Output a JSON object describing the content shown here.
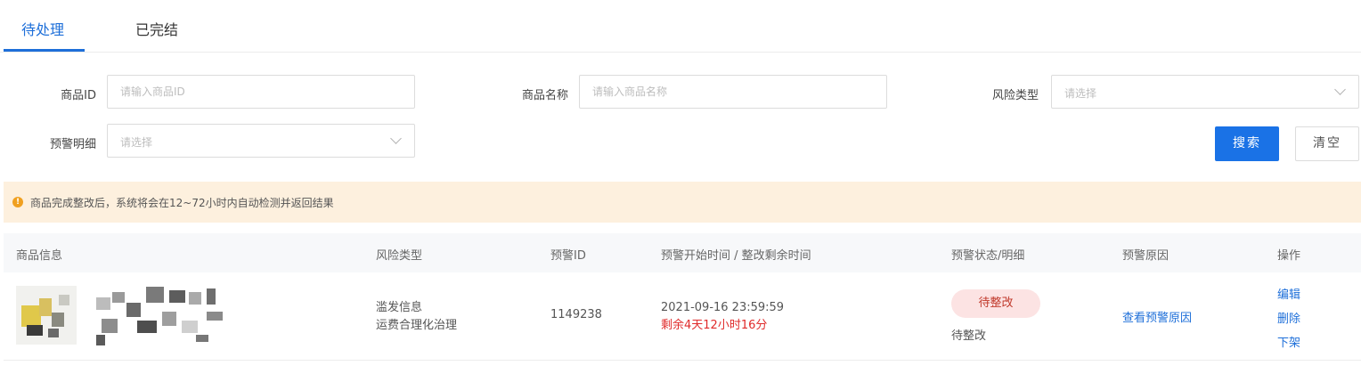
{
  "tabs": [
    {
      "label": "待处理",
      "active": true
    },
    {
      "label": "已完结",
      "active": false
    }
  ],
  "filters": {
    "product_id": {
      "label": "商品ID",
      "placeholder": "请输入商品ID",
      "value": ""
    },
    "product_name": {
      "label": "商品名称",
      "placeholder": "请输入商品名称",
      "value": ""
    },
    "risk_type": {
      "label": "风险类型",
      "placeholder": "请选择"
    },
    "alert_detail": {
      "label": "预警明细",
      "placeholder": "请选择"
    },
    "search_label": "搜索",
    "clear_label": "清空"
  },
  "notice": {
    "text": "商品完成整改后，系统将会在12~72小时内自动检测并返回结果"
  },
  "table": {
    "headers": {
      "product_info": "商品信息",
      "risk_type": "风险类型",
      "alert_id": "预警ID",
      "time": "预警开始时间 / 整改剩余时间",
      "status": "预警状态/明细",
      "reason": "预警原因",
      "actions": "操作"
    },
    "rows": [
      {
        "risk_type_lines": [
          "滥发信息",
          "运费合理化治理"
        ],
        "alert_id": "1149238",
        "start_time": "2021-09-16 23:59:59",
        "remaining": "剩余4天12小时16分",
        "status_badge": "待整改",
        "status_detail": "待整改",
        "reason_link": "查看预警原因",
        "actions": [
          "编辑",
          "删除",
          "下架"
        ]
      }
    ]
  },
  "colors": {
    "accent": "#1e6fd9",
    "primary_button": "#1a72e6",
    "notice_bg": "#fdf0de",
    "warning_icon": "#f0a020",
    "remaining_text": "#e02b2b",
    "status_pill_bg": "#fce3e3"
  },
  "icons": {
    "notice": "warning-circle-icon",
    "select": "chevron-down-icon"
  }
}
